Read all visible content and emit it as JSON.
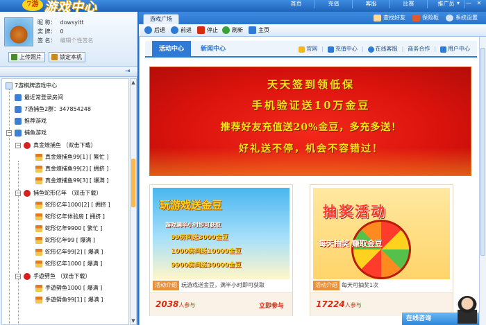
{
  "app": {
    "logo_badge": "7游",
    "logo_title": "游戏中心",
    "top_nav": [
      "首页",
      "充值",
      "客服",
      "比赛",
      "推广员"
    ],
    "window_controls": [
      "▾",
      "—",
      "✕"
    ]
  },
  "profile": {
    "nickname_label": "昵 称：",
    "nickname": "dowsyitt",
    "lottery_label": "奖 牌：",
    "lottery": "0",
    "sign_label": "签 名：",
    "sign_placeholder": "编辑个性签名",
    "upload_btn": "上传照片",
    "lock_btn": "锁定本机"
  },
  "tree": {
    "pin_icon": "⇥",
    "root": "7游棋牌游戏中心",
    "items": [
      {
        "label": "最近常登录房间",
        "icon": "blue"
      },
      {
        "label": "7游捕鱼2群：347854248",
        "icon": "blue"
      },
      {
        "label": "推荐游戏",
        "icon": "blue"
      },
      {
        "label": "捕鱼游戏",
        "icon": "blue"
      }
    ],
    "games": [
      {
        "name": "真金燎捕鱼 （双击下载）",
        "rooms": [
          "真金燎捕鱼99[1] [ 繁忙 ]",
          "真金燎捕鱼99[2] [ 拥挤 ]",
          "真金燎捕鱼99[3] [ 爆满 ]"
        ]
      },
      {
        "name": "捕鱼蛇形亿年 （双击下载）",
        "rooms": [
          "蛇形亿年1000[2] [ 拥挤 ]",
          "蛇形亿年体验房 [ 拥挤 ]",
          "蛇形亿年9900 [ 繁忙 ]",
          "蛇形亿年99 [ 爆满 ]",
          "蛇形亿年99[2] [ 爆满 ]",
          "蛇形亿年1000 [ 爆满 ]"
        ]
      },
      {
        "name": "手遊劈鱼 （双击下载）",
        "rooms": [
          "手遊劈鱼1000 [ 爆满 ]",
          "手遊劈鱼99[1] [ 爆满 ]"
        ]
      }
    ]
  },
  "tabs": {
    "active": "游戏广场",
    "tools": [
      "查找好友",
      "保险柜",
      "系统设置"
    ]
  },
  "toolbar": {
    "back": "后退",
    "forward": "前进",
    "stop": "停止",
    "refresh": "刷新",
    "home": "主页"
  },
  "content_nav": {
    "active": "活动中心",
    "news": "新闻中心",
    "links": [
      "官网",
      "充值中心",
      "在线客服",
      "商务合作",
      "用户中心"
    ]
  },
  "banner": {
    "lines": [
      "天天签到领低保",
      "手机验证送10万金豆",
      "推荐好友充值送20%金豆，多充多送！",
      "好礼送不停，机会不容错过！"
    ]
  },
  "cards": [
    {
      "img_title": "玩游戏送金豆",
      "img_sub": "游戏满半小时即可获取",
      "img_lines": [
        "99房间送3000金豆",
        "1000房间送10000金豆",
        "9900房间送30000金豆"
      ],
      "tag": "活动介绍",
      "desc": "玩游戏送金豆，满半小时即可获取",
      "count": "2038",
      "count_unit": "人参与",
      "join": "立即参与"
    },
    {
      "img_title": "抽奖活动",
      "img_sub": "每天抽奖 赚取金豆",
      "tag": "活动介绍",
      "desc": "每天可抽奖1次",
      "count": "17224",
      "count_unit": "人参与"
    }
  ],
  "consult": {
    "label": "在线咨询"
  }
}
